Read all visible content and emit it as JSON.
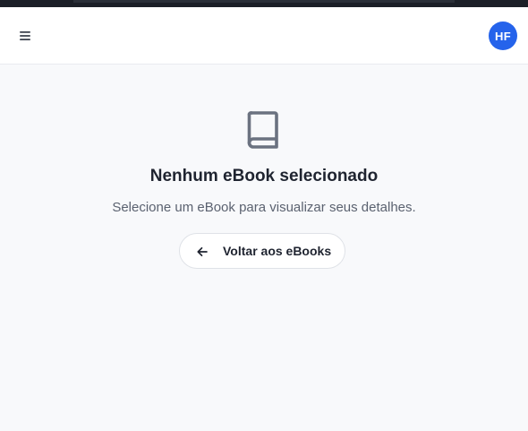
{
  "header": {
    "menu_icon": "hamburger-menu-icon",
    "avatar_initials": "HF",
    "avatar_color": "#2563eb"
  },
  "empty_state": {
    "icon": "book-icon",
    "title": "Nenhum eBook selecionado",
    "subtitle": "Selecione um eBook para visualizar seus detalhes.",
    "back_button": {
      "icon": "arrow-left-icon",
      "label": "Voltar aos eBooks"
    }
  },
  "colors": {
    "top_strip": "#1b1f27",
    "background": "#f8f9fb",
    "icon_gray": "#6b7280"
  }
}
